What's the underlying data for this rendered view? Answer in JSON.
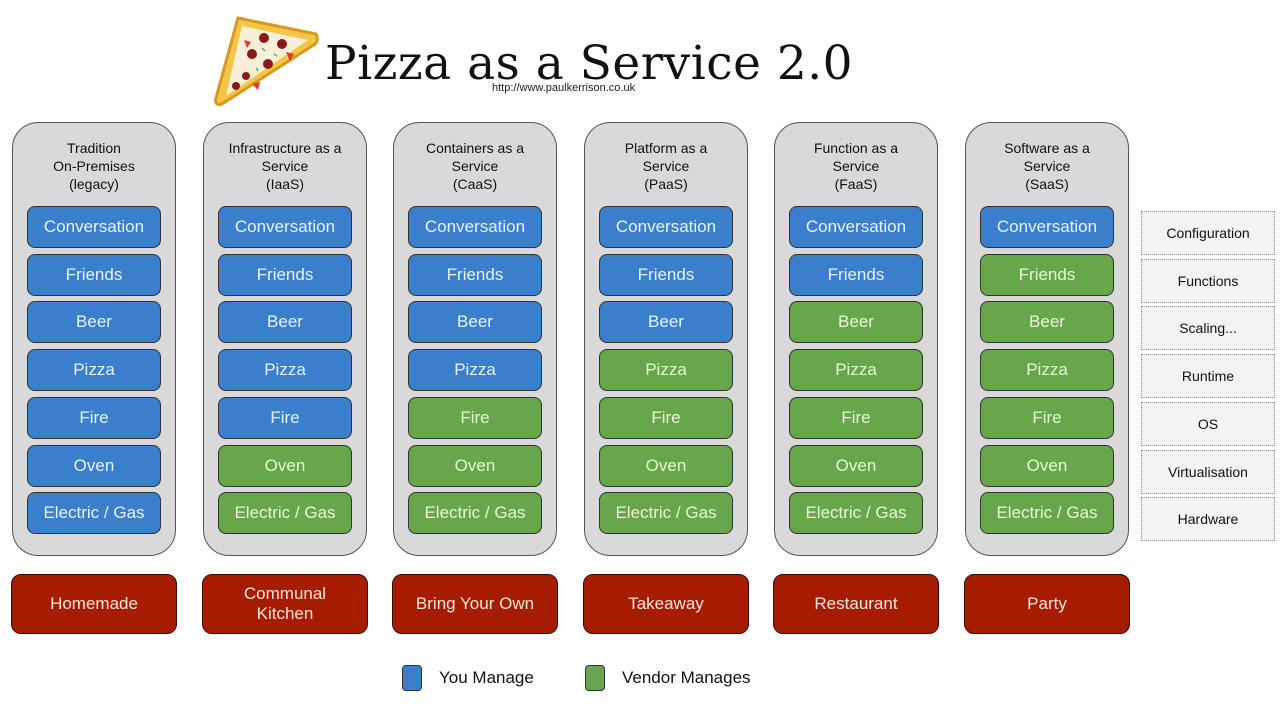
{
  "header": {
    "title": "Pizza as a Service 2.0",
    "subtitle": "http://www.paulkerrison.co.uk",
    "logo_icon": "pizza-slice-icon"
  },
  "colors": {
    "you_manage": "#3a7fcb",
    "vendor_manages": "#67a64a",
    "analogy": "#a61c00",
    "column_bg": "#d9d9d9"
  },
  "columns": [
    {
      "title": "Tradition\nOn-Premises\n(legacy)",
      "analogy": "Homemade",
      "layers": [
        {
          "label": "Conversation",
          "manager": "you"
        },
        {
          "label": "Friends",
          "manager": "you"
        },
        {
          "label": "Beer",
          "manager": "you"
        },
        {
          "label": "Pizza",
          "manager": "you"
        },
        {
          "label": "Fire",
          "manager": "you"
        },
        {
          "label": "Oven",
          "manager": "you"
        },
        {
          "label": "Electric / Gas",
          "manager": "you"
        }
      ]
    },
    {
      "title": "Infrastructure as a\nService\n(IaaS)",
      "analogy": "Communal\nKitchen",
      "layers": [
        {
          "label": "Conversation",
          "manager": "you"
        },
        {
          "label": "Friends",
          "manager": "you"
        },
        {
          "label": "Beer",
          "manager": "you"
        },
        {
          "label": "Pizza",
          "manager": "you"
        },
        {
          "label": "Fire",
          "manager": "you"
        },
        {
          "label": "Oven",
          "manager": "vendor"
        },
        {
          "label": "Electric / Gas",
          "manager": "vendor"
        }
      ]
    },
    {
      "title": "Containers as a\nService\n(CaaS)",
      "analogy": "Bring Your Own",
      "layers": [
        {
          "label": "Conversation",
          "manager": "you"
        },
        {
          "label": "Friends",
          "manager": "you"
        },
        {
          "label": "Beer",
          "manager": "you"
        },
        {
          "label": "Pizza",
          "manager": "you"
        },
        {
          "label": "Fire",
          "manager": "vendor"
        },
        {
          "label": "Oven",
          "manager": "vendor"
        },
        {
          "label": "Electric / Gas",
          "manager": "vendor"
        }
      ]
    },
    {
      "title": "Platform as a\nService\n(PaaS)",
      "analogy": "Takeaway",
      "layers": [
        {
          "label": "Conversation",
          "manager": "you"
        },
        {
          "label": "Friends",
          "manager": "you"
        },
        {
          "label": "Beer",
          "manager": "you"
        },
        {
          "label": "Pizza",
          "manager": "vendor"
        },
        {
          "label": "Fire",
          "manager": "vendor"
        },
        {
          "label": "Oven",
          "manager": "vendor"
        },
        {
          "label": "Electric / Gas",
          "manager": "vendor"
        }
      ]
    },
    {
      "title": "Function as a\nService\n(FaaS)",
      "analogy": "Restaurant",
      "layers": [
        {
          "label": "Conversation",
          "manager": "you"
        },
        {
          "label": "Friends",
          "manager": "you"
        },
        {
          "label": "Beer",
          "manager": "vendor"
        },
        {
          "label": "Pizza",
          "manager": "vendor"
        },
        {
          "label": "Fire",
          "manager": "vendor"
        },
        {
          "label": "Oven",
          "manager": "vendor"
        },
        {
          "label": "Electric / Gas",
          "manager": "vendor"
        }
      ]
    },
    {
      "title": "Software as a\nService\n(SaaS)",
      "analogy": "Party",
      "layers": [
        {
          "label": "Conversation",
          "manager": "you"
        },
        {
          "label": "Friends",
          "manager": "vendor"
        },
        {
          "label": "Beer",
          "manager": "vendor"
        },
        {
          "label": "Pizza",
          "manager": "vendor"
        },
        {
          "label": "Fire",
          "manager": "vendor"
        },
        {
          "label": "Oven",
          "manager": "vendor"
        },
        {
          "label": "Electric / Gas",
          "manager": "vendor"
        }
      ]
    }
  ],
  "side_labels": [
    "Configuration",
    "Functions",
    "Scaling...",
    "Runtime",
    "OS",
    "Virtualisation",
    "Hardware"
  ],
  "legend": [
    {
      "label": "You Manage",
      "manager": "you"
    },
    {
      "label": "Vendor Manages",
      "manager": "vendor"
    }
  ]
}
